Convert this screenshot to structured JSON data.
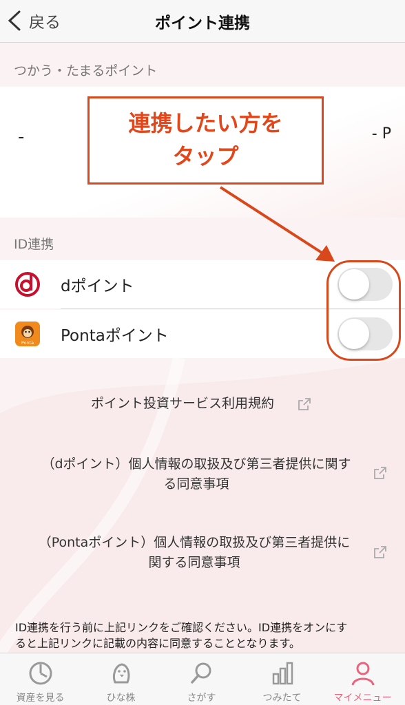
{
  "header": {
    "back_label": "戻る",
    "title": "ポイント連携"
  },
  "points_section": {
    "label": "つかう・たまるポイント",
    "left_value": "-",
    "right_value": "- P"
  },
  "callout": {
    "line1": "連携したい方を",
    "line2": "タップ"
  },
  "id_section": {
    "label": "ID連携",
    "items": [
      {
        "label": "dポイント",
        "icon": "d-point-logo",
        "toggle_on": false
      },
      {
        "label": "Pontaポイント",
        "icon": "ponta-logo",
        "toggle_on": false
      }
    ],
    "ponta_logo_text": "Ponta"
  },
  "links": {
    "terms": "ポイント投資サービス利用規約",
    "dpoint_consent_line1": "（dポイント）個人情報の取扱及び第三者提供に関す",
    "dpoint_consent_line2": "る同意事項",
    "ponta_consent_line1": "（Pontaポイント）個人情報の取扱及び第三者提供に",
    "ponta_consent_line2": "関する同意事項"
  },
  "notice": {
    "line1": "ID連携を行う前に上記リンクをご確認ください。ID連携をオンにす",
    "line2": "ると上記リンクに記載の内容に同意することとなります。"
  },
  "tabbar": {
    "items": [
      {
        "label": "資産を見る",
        "icon": "pie-clock-icon"
      },
      {
        "label": "ひな株",
        "icon": "chick-icon"
      },
      {
        "label": "さがす",
        "icon": "search-icon"
      },
      {
        "label": "つみたて",
        "icon": "bar-chart-icon"
      },
      {
        "label": "マイメニュー",
        "icon": "person-icon"
      }
    ],
    "active_index": 4
  },
  "colors": {
    "accent": "#e8647d",
    "annotation": "#d9481a",
    "dpoint": "#c8102e",
    "ponta": "#f08a1d"
  }
}
